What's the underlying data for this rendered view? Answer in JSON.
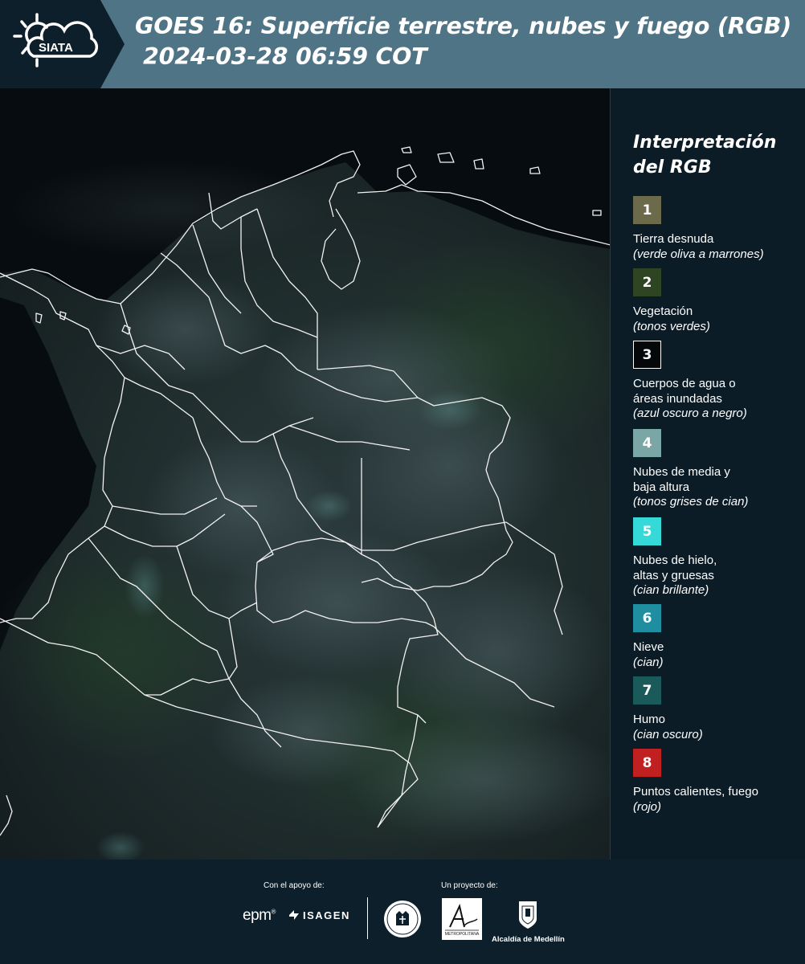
{
  "header": {
    "logo_text": "SIATA",
    "title_line1": "GOES 16: Superficie terrestre, nubes y fuego (RGB)",
    "title_line2": "2024-03-28 06:59 COT",
    "colors": {
      "dark": "#0e1f2c",
      "band": "#4f7486"
    }
  },
  "legend": {
    "title_line1": "Interpretación",
    "title_line2": "del RGB",
    "items": [
      {
        "number": "1",
        "color": "#6b6a4a",
        "label": "Tierra desnuda",
        "sub": "(verde oliva a marrones)"
      },
      {
        "number": "2",
        "color": "#2e4422",
        "label": "Vegetación",
        "sub": "(tonos verdes)"
      },
      {
        "number": "3",
        "color": "#05080a",
        "label": "Cuerpos de agua o áreas inundadas",
        "sub": "(azul oscuro a negro)"
      },
      {
        "number": "4",
        "color": "#7aa6a5",
        "label": "Nubes de media y baja altura",
        "sub": "(tonos grises de cian)"
      },
      {
        "number": "5",
        "color": "#35dad8",
        "label": "Nubes de hielo, altas y gruesas",
        "sub": "(cian brillante)"
      },
      {
        "number": "6",
        "color": "#1e8ea0",
        "label": "Nieve",
        "sub": "(cian)"
      },
      {
        "number": "7",
        "color": "#1b5a5a",
        "label": "Humo",
        "sub": "(cian oscuro)"
      },
      {
        "number": "8",
        "color": "#c0201f",
        "label": "Puntos calientes, fuego",
        "sub": "(rojo)"
      }
    ]
  },
  "footer": {
    "support_label": "Con el apoyo de:",
    "project_label": "Un proyecto de:",
    "epm_text": "epm",
    "isagen_text": "ISAGEN",
    "area_text": "METROPOLITANA",
    "alcaldia_text": "Alcaldía de Medellín"
  }
}
